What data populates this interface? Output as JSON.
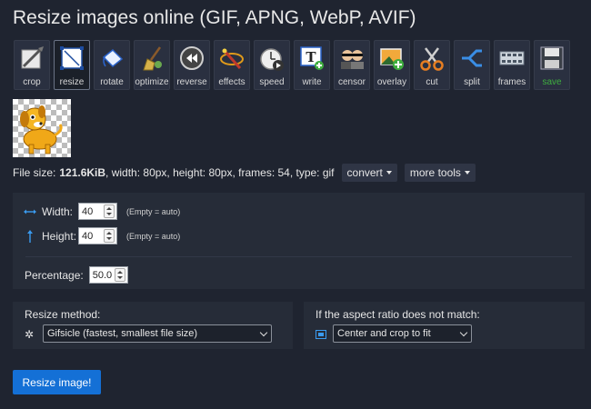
{
  "page": {
    "title": "Resize images online (GIF, APNG, WebP, AVIF)"
  },
  "toolbar": [
    {
      "id": "crop",
      "label": "crop",
      "icon": "crop-icon"
    },
    {
      "id": "resize",
      "label": "resize",
      "icon": "resize-icon",
      "active": true
    },
    {
      "id": "rotate",
      "label": "rotate",
      "icon": "rotate-icon"
    },
    {
      "id": "optimize",
      "label": "optimize",
      "icon": "broom-icon"
    },
    {
      "id": "reverse",
      "label": "reverse",
      "icon": "rewind-icon"
    },
    {
      "id": "effects",
      "label": "effects",
      "icon": "magic-wand-icon"
    },
    {
      "id": "speed",
      "label": "speed",
      "icon": "stopwatch-icon"
    },
    {
      "id": "write",
      "label": "write",
      "icon": "text-icon"
    },
    {
      "id": "censor",
      "label": "censor",
      "icon": "censor-faces-icon"
    },
    {
      "id": "overlay",
      "label": "overlay",
      "icon": "overlay-image-icon"
    },
    {
      "id": "cut",
      "label": "cut",
      "icon": "scissors-icon"
    },
    {
      "id": "split",
      "label": "split",
      "icon": "split-icon"
    },
    {
      "id": "frames",
      "label": "frames",
      "icon": "film-strip-icon"
    },
    {
      "id": "save",
      "label": "save",
      "icon": "floppy-disk-icon",
      "color": "#3fae3f"
    }
  ],
  "fileinfo": {
    "prefix": "File size:",
    "size": "121.6KiB",
    "details": ", width: 80px, height: 80px, frames: 54, type: gif",
    "convert": "convert",
    "more_tools": "more tools"
  },
  "form": {
    "width_label": "Width:",
    "width_value": "40",
    "height_label": "Height:",
    "height_value": "40",
    "empty_hint": "(Empty = auto)",
    "percentage_label": "Percentage:",
    "percentage_value": "50.0",
    "method_label": "Resize method:",
    "method_value": "Gifsicle (fastest, smallest file size)",
    "aspect_label": "If the aspect ratio does not match:",
    "aspect_value": "Center and crop to fit",
    "submit": "Resize image!"
  },
  "colors": {
    "accent": "#1470d6",
    "background": "#1f2430",
    "panel": "#262c38",
    "save_green": "#3fae3f"
  }
}
